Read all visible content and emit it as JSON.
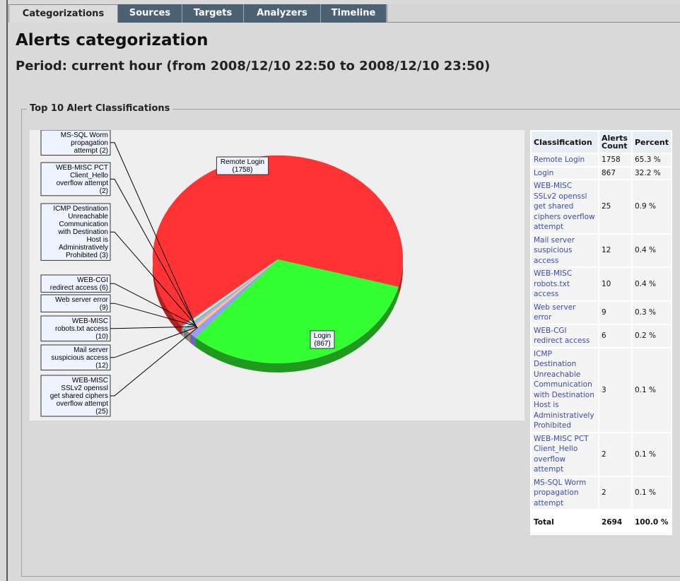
{
  "tabs": [
    {
      "label": "Categorizations",
      "active": true
    },
    {
      "label": "Sources",
      "active": false
    },
    {
      "label": "Targets",
      "active": false
    },
    {
      "label": "Analyzers",
      "active": false
    },
    {
      "label": "Timeline",
      "active": false
    }
  ],
  "page": {
    "title": "Alerts categorization",
    "subtitle": "Period: current hour (from 2008/12/10 22:50 to 2008/12/10 23:50)"
  },
  "section": {
    "legend": "Top 10 Alert Classifications"
  },
  "colors": {
    "remote_login": "#ff3333",
    "login": "#33ff33",
    "others": [
      "#9999ff",
      "#ffcc66",
      "#cc99ff",
      "#66cccc",
      "#ffff99",
      "#999999",
      "#ff99cc",
      "#3333cc"
    ]
  },
  "chart_labels": {
    "remote_login": "Remote Login\n(1758)",
    "login": "Login\n(867)",
    "callouts": [
      "MS-SQL Worm\npropagation\nattempt (2)",
      "WEB-MISC PCT\nClient_Hello\noverflow attempt\n(2)",
      "ICMP Destination\nUnreachable\nCommunication\nwith Destination\nHost is\nAdministratively\nProhibited (3)",
      "WEB-CGI\nredirect access (6)",
      "Web server error\n(9)",
      "WEB-MISC\nrobots.txt access\n(10)",
      "Mail server\nsuspicious access\n(12)",
      "WEB-MISC\nSSLv2 openssl\nget shared ciphers\noverflow attempt\n(25)"
    ]
  },
  "table": {
    "headers": {
      "classification": "Classification",
      "count": "Alerts Count",
      "percent": "Percent"
    },
    "rows": [
      {
        "classification": "Remote Login",
        "count": "1758",
        "percent": "65.3 %"
      },
      {
        "classification": "Login",
        "count": "867",
        "percent": "32.2 %"
      },
      {
        "classification": "WEB-MISC SSLv2 openssl get shared ciphers overflow attempt",
        "count": "25",
        "percent": "0.9 %"
      },
      {
        "classification": "Mail server suspicious access",
        "count": "12",
        "percent": "0.4 %"
      },
      {
        "classification": "WEB-MISC robots.txt access",
        "count": "10",
        "percent": "0.4 %"
      },
      {
        "classification": "Web server error",
        "count": "9",
        "percent": "0.3 %"
      },
      {
        "classification": "WEB-CGI redirect access",
        "count": "6",
        "percent": "0.2 %"
      },
      {
        "classification": "ICMP Destination Unreachable Communication with Destination Host is Administratively Prohibited",
        "count": "3",
        "percent": "0.1 %"
      },
      {
        "classification": "WEB-MISC PCT Client_Hello overflow attempt",
        "count": "2",
        "percent": "0.1 %"
      },
      {
        "classification": "MS-SQL Worm propagation attempt",
        "count": "2",
        "percent": "0.1 %"
      }
    ],
    "total": {
      "label": "Total",
      "count": "2694",
      "percent": "100.0 %"
    }
  },
  "chart_data": {
    "type": "pie",
    "title": "Top 10 Alert Classifications",
    "categories": [
      "Remote Login",
      "Login",
      "WEB-MISC SSLv2 openssl get shared ciphers overflow attempt",
      "Mail server suspicious access",
      "WEB-MISC robots.txt access",
      "Web server error",
      "WEB-CGI redirect access",
      "ICMP Destination Unreachable Communication with Destination Host is Administratively Prohibited",
      "WEB-MISC PCT Client_Hello overflow attempt",
      "MS-SQL Worm propagation attempt"
    ],
    "values": [
      1758,
      867,
      25,
      12,
      10,
      9,
      6,
      3,
      2,
      2
    ]
  }
}
